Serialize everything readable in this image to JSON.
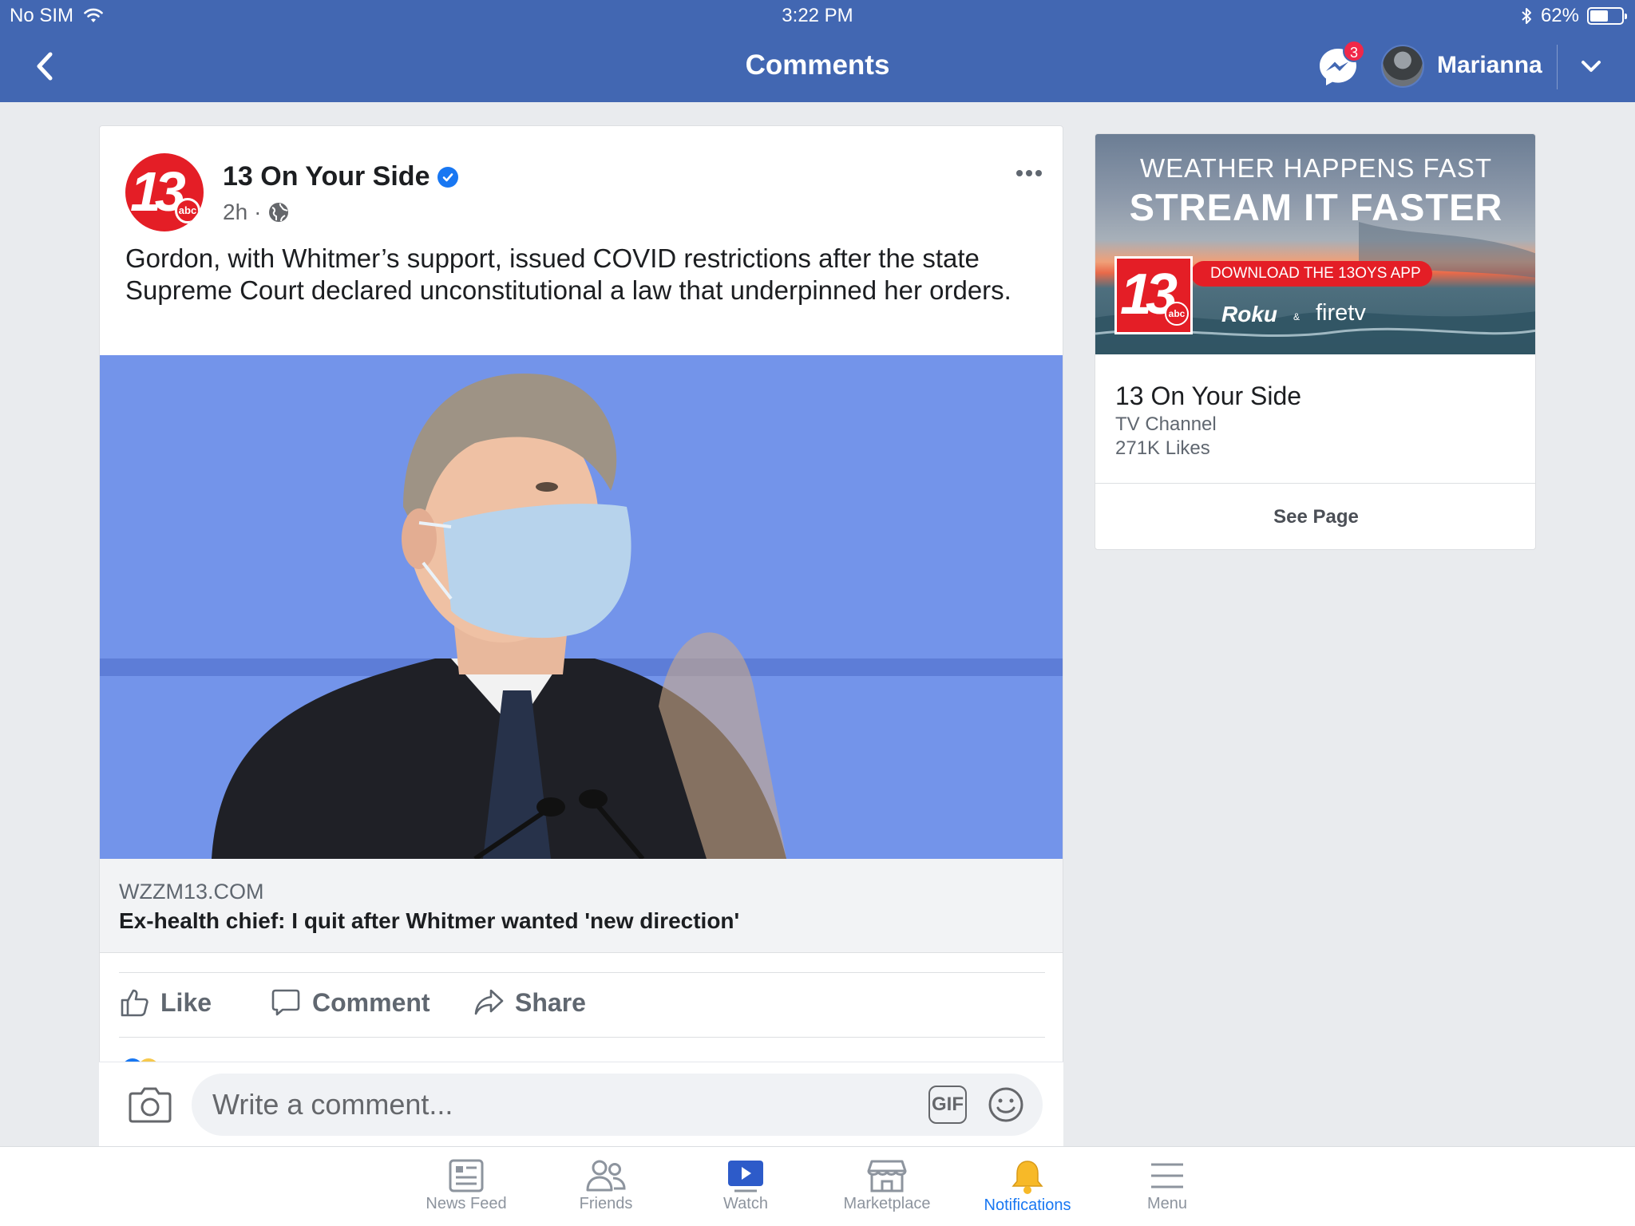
{
  "status_bar": {
    "carrier": "No SIM",
    "time": "3:22 PM",
    "battery": "62%",
    "battery_level": 0.62
  },
  "nav": {
    "title": "Comments",
    "messenger_badge": "3",
    "user_name": "Marianna"
  },
  "post": {
    "page_logo_number": "13",
    "page_logo_sub": "abc",
    "page_name": "13 On Your Side",
    "time": "2h",
    "separator": "·",
    "text": "Gordon, with Whitmer’s support, issued COVID restrictions after the state Supreme Court declared unconstitutional a law that underpinned her orders.",
    "link": {
      "domain": "WZZM13.COM",
      "title": "Ex-health chief: I quit after Whitmer wanted 'new direction'"
    },
    "actions": {
      "like": "Like",
      "comment": "Comment",
      "share": "Share"
    }
  },
  "composer": {
    "placeholder": "Write a comment...",
    "gif_label": "GIF"
  },
  "sidebar_card": {
    "banner": {
      "line1": "WEATHER HAPPENS FAST",
      "line2": "STREAM IT FASTER",
      "pill": "DOWNLOAD THE 13OYS APP",
      "logo_number": "13",
      "logo_sub": "abc",
      "roku": "Roku",
      "amp": "&",
      "firetv": "firetv"
    },
    "name": "13 On Your Side",
    "category": "TV Channel",
    "likes": "271K Likes",
    "see_page": "See Page"
  },
  "tabs": [
    {
      "label": "News Feed",
      "icon": "news-feed-icon"
    },
    {
      "label": "Friends",
      "icon": "friends-icon"
    },
    {
      "label": "Watch",
      "icon": "watch-icon"
    },
    {
      "label": "Marketplace",
      "icon": "marketplace-icon"
    },
    {
      "label": "Notifications",
      "icon": "notifications-icon",
      "active": true
    },
    {
      "label": "Menu",
      "icon": "menu-icon"
    }
  ],
  "colors": {
    "brand": "#4267b2",
    "active_tab": "#1877f2",
    "station_red": "#e41e26",
    "badge_red": "#f02849"
  }
}
